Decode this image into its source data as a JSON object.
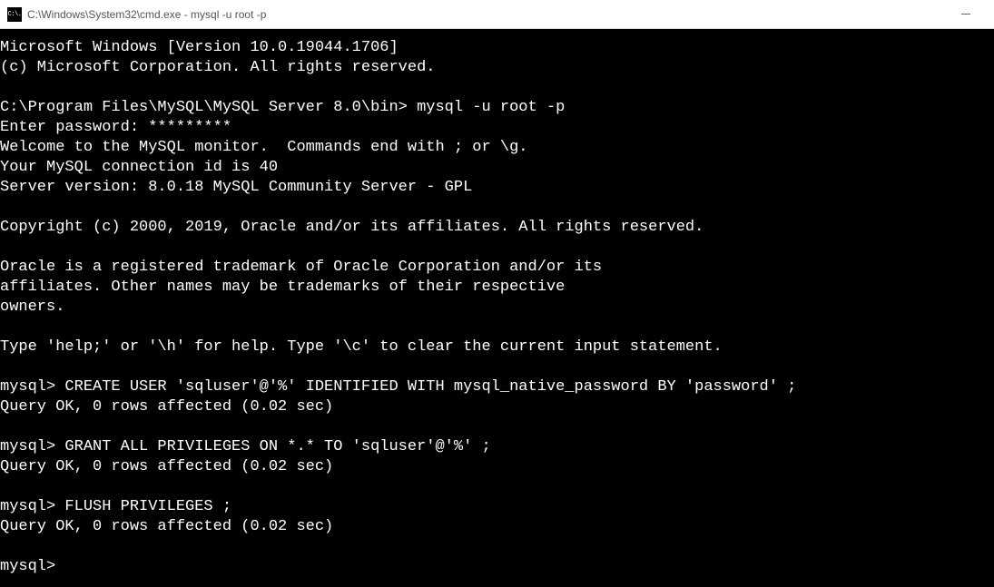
{
  "titlebar": {
    "icon_text": "C:\\.",
    "title": "C:\\Windows\\System32\\cmd.exe - mysql  -u root -p"
  },
  "term": {
    "l01": "Microsoft Windows [Version 10.0.19044.1706]",
    "l02": "(c) Microsoft Corporation. All rights reserved.",
    "l03": "",
    "l04": "C:\\Program Files\\MySQL\\MySQL Server 8.0\\bin> mysql -u root -p",
    "l05": "Enter password: *********",
    "l06": "Welcome to the MySQL monitor.  Commands end with ; or \\g.",
    "l07": "Your MySQL connection id is 40",
    "l08": "Server version: 8.0.18 MySQL Community Server - GPL",
    "l09": "",
    "l10": "Copyright (c) 2000, 2019, Oracle and/or its affiliates. All rights reserved.",
    "l11": "",
    "l12": "Oracle is a registered trademark of Oracle Corporation and/or its",
    "l13": "affiliates. Other names may be trademarks of their respective",
    "l14": "owners.",
    "l15": "",
    "l16": "Type 'help;' or '\\h' for help. Type '\\c' to clear the current input statement.",
    "l17": "",
    "l18": "mysql> CREATE USER 'sqluser'@'%' IDENTIFIED WITH mysql_native_password BY 'password' ;",
    "l19": "Query OK, 0 rows affected (0.02 sec)",
    "l20": "",
    "l21": "mysql> GRANT ALL PRIVILEGES ON *.* TO 'sqluser'@'%' ;",
    "l22": "Query OK, 0 rows affected (0.02 sec)",
    "l23": "",
    "l24": "mysql> FLUSH PRIVILEGES ;",
    "l25": "Query OK, 0 rows affected (0.02 sec)",
    "l26": "",
    "l27": "mysql>"
  }
}
